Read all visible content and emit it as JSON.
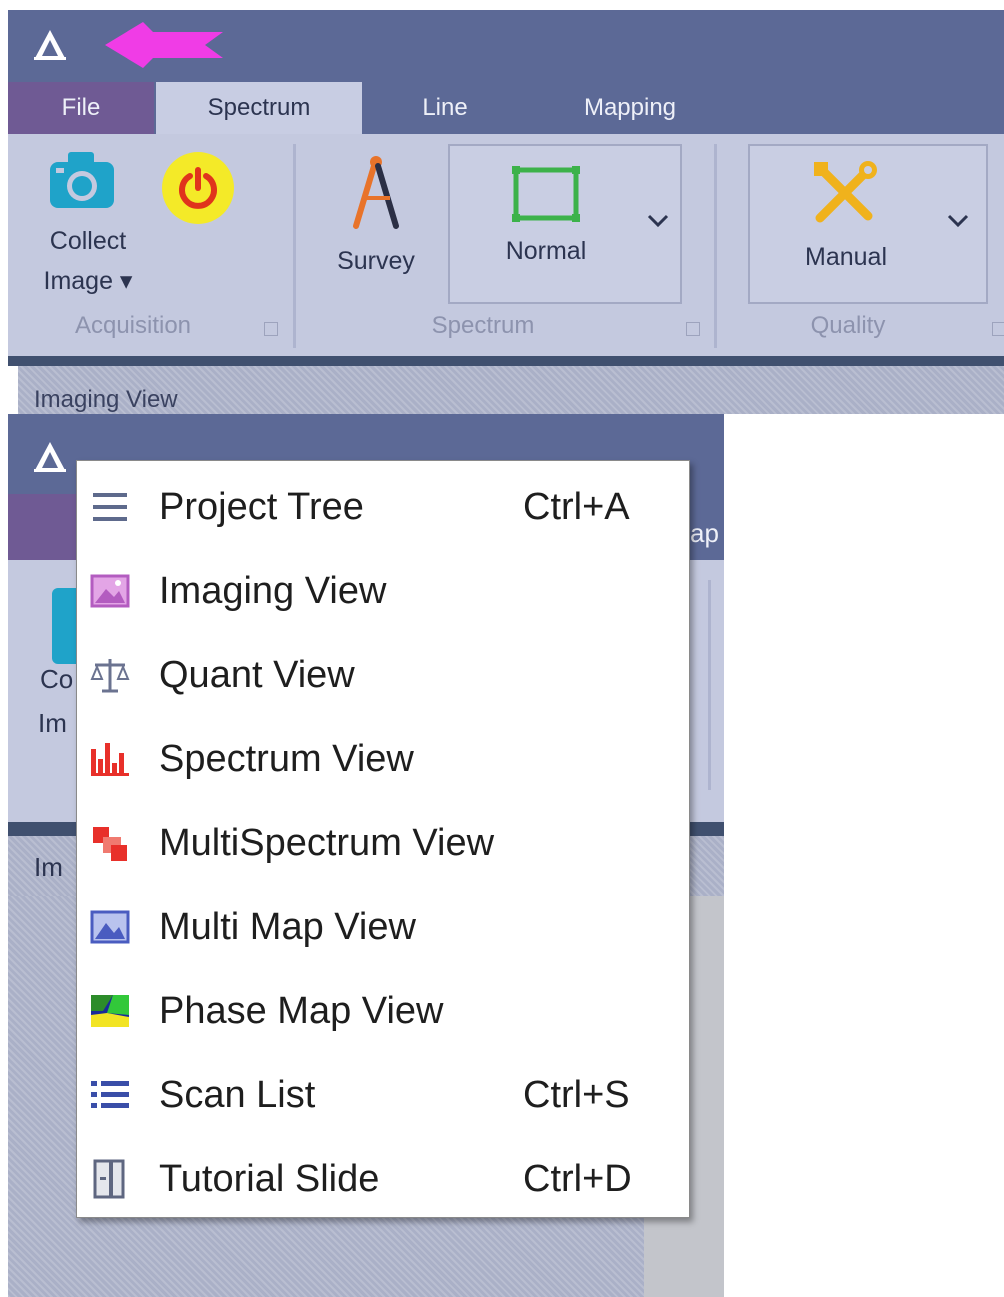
{
  "app": {
    "tabs": {
      "file": "File",
      "spectrum": "Spectrum",
      "line": "Line",
      "mapping": "Mapping"
    }
  },
  "ribbon": {
    "acquisition": {
      "collect_label_line1": "Collect",
      "collect_label_line2": "Image ▾",
      "group_label": "Acquisition"
    },
    "spectrum": {
      "survey_label": "Survey",
      "mode_label": "Normal",
      "group_label": "Spectrum"
    },
    "quality": {
      "manual_label": "Manual",
      "group_label": "Quality"
    }
  },
  "panel": {
    "title": "Imaging View"
  },
  "nested": {
    "frag_tab": "ap",
    "frag_co": "Co",
    "frag_im": "Im",
    "frag_panel": "Im"
  },
  "menu": {
    "items": [
      {
        "label": "Project Tree",
        "shortcut": "Ctrl+A",
        "icon": "project-tree-icon"
      },
      {
        "label": "Imaging View",
        "shortcut": "",
        "icon": "imaging-view-icon"
      },
      {
        "label": "Quant View",
        "shortcut": "",
        "icon": "quant-view-icon"
      },
      {
        "label": "Spectrum View",
        "shortcut": "",
        "icon": "spectrum-view-icon"
      },
      {
        "label": "MultiSpectrum View",
        "shortcut": "",
        "icon": "multispectrum-view-icon"
      },
      {
        "label": "Multi Map View",
        "shortcut": "",
        "icon": "multi-map-view-icon"
      },
      {
        "label": "Phase Map View",
        "shortcut": "",
        "icon": "phase-map-view-icon"
      },
      {
        "label": "Scan List",
        "shortcut": "Ctrl+S",
        "icon": "scan-list-icon"
      },
      {
        "label": "Tutorial Slide",
        "shortcut": "Ctrl+D",
        "icon": "tutorial-slide-icon"
      }
    ]
  },
  "colors": {
    "titlebar": "#5c6996",
    "file_tab": "#6f5a94",
    "ribbon": "#c4c9df",
    "power_button": "#f4ea28",
    "power_symbol": "#e0341c",
    "annotation_arrow": "#f03ce6"
  }
}
